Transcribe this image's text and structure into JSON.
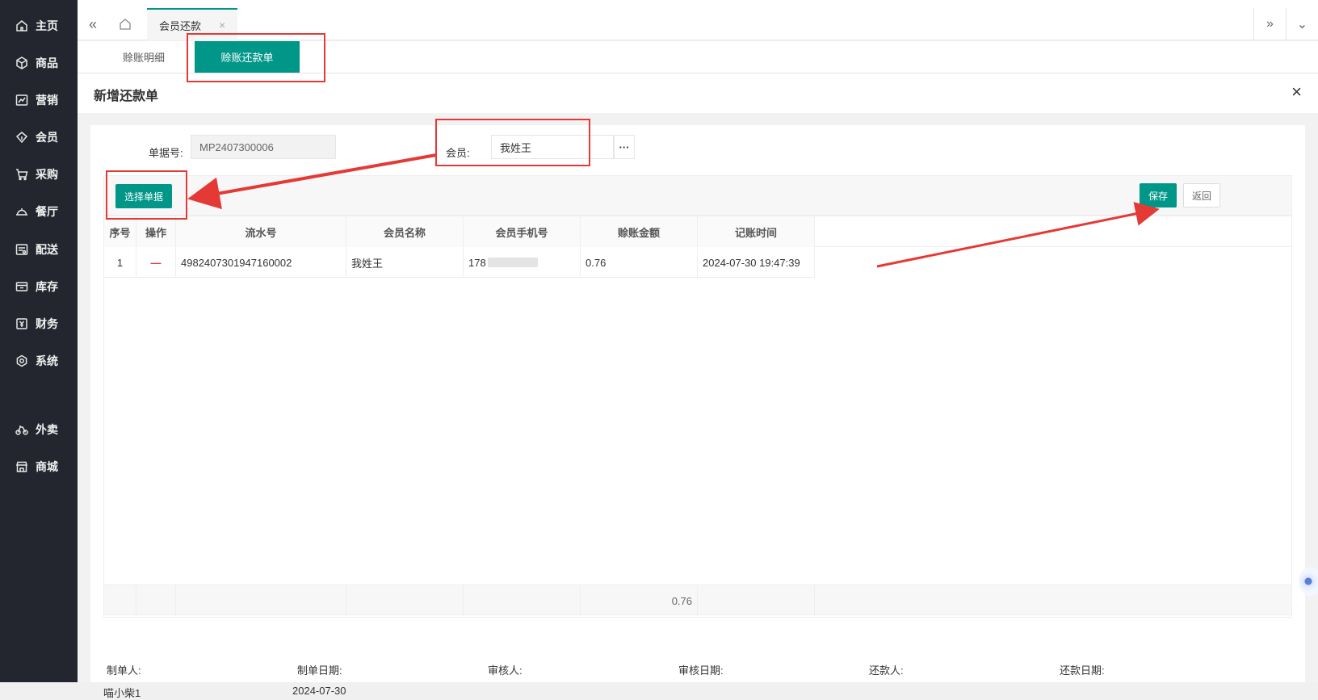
{
  "sidebar": {
    "items": [
      {
        "label": "主页",
        "icon": "home-icon"
      },
      {
        "label": "商品",
        "icon": "box-icon"
      },
      {
        "label": "营销",
        "icon": "chart-icon"
      },
      {
        "label": "会员",
        "icon": "diamond-icon"
      },
      {
        "label": "采购",
        "icon": "cart-icon"
      },
      {
        "label": "餐厅",
        "icon": "dish-icon"
      },
      {
        "label": "配送",
        "icon": "delivery-icon"
      },
      {
        "label": "库存",
        "icon": "inventory-icon"
      },
      {
        "label": "财务",
        "icon": "finance-icon"
      },
      {
        "label": "系统",
        "icon": "settings-icon"
      },
      {
        "label": "外卖",
        "icon": "bike-icon"
      },
      {
        "label": "商城",
        "icon": "store-icon"
      }
    ]
  },
  "tabbar": {
    "tab_label": "会员还款",
    "close_glyph": "×",
    "home_icon": "home-icon"
  },
  "subtabs": {
    "detail": "赊账明细",
    "repay_order": "赊账还款单"
  },
  "modal": {
    "title": "新增还款单",
    "close_glyph": "×"
  },
  "form": {
    "doc_no_label": "单据号:",
    "doc_no_value": "MP2407300006",
    "member_label": "会员:",
    "member_value": "我姓王",
    "more_glyph": "···"
  },
  "toolbar": {
    "select_label": "选择单据",
    "save_label": "保存",
    "back_label": "返回"
  },
  "table": {
    "headers": [
      "序号",
      "操作",
      "流水号",
      "会员名称",
      "会员手机号",
      "赊账金额",
      "记账时间"
    ],
    "rows": [
      {
        "index": "1",
        "op": "—",
        "serial": "4982407301947160002",
        "member": "我姓王",
        "phone": "178",
        "amount": "0.76",
        "time": "2024-07-30 19:47:39"
      }
    ],
    "footer_total": "0.76"
  },
  "footer": {
    "creator_label": "制单人:",
    "creator_value": "喵小柴1",
    "create_date_label": "制单日期:",
    "create_date_value": "2024-07-30",
    "auditor_label": "审核人:",
    "audit_date_label": "审核日期:",
    "repayer_label": "还款人:",
    "repay_date_label": "还款日期:"
  },
  "colors": {
    "accent": "#009688",
    "annotation": "#e53935",
    "sidebar_bg": "#23262e"
  }
}
